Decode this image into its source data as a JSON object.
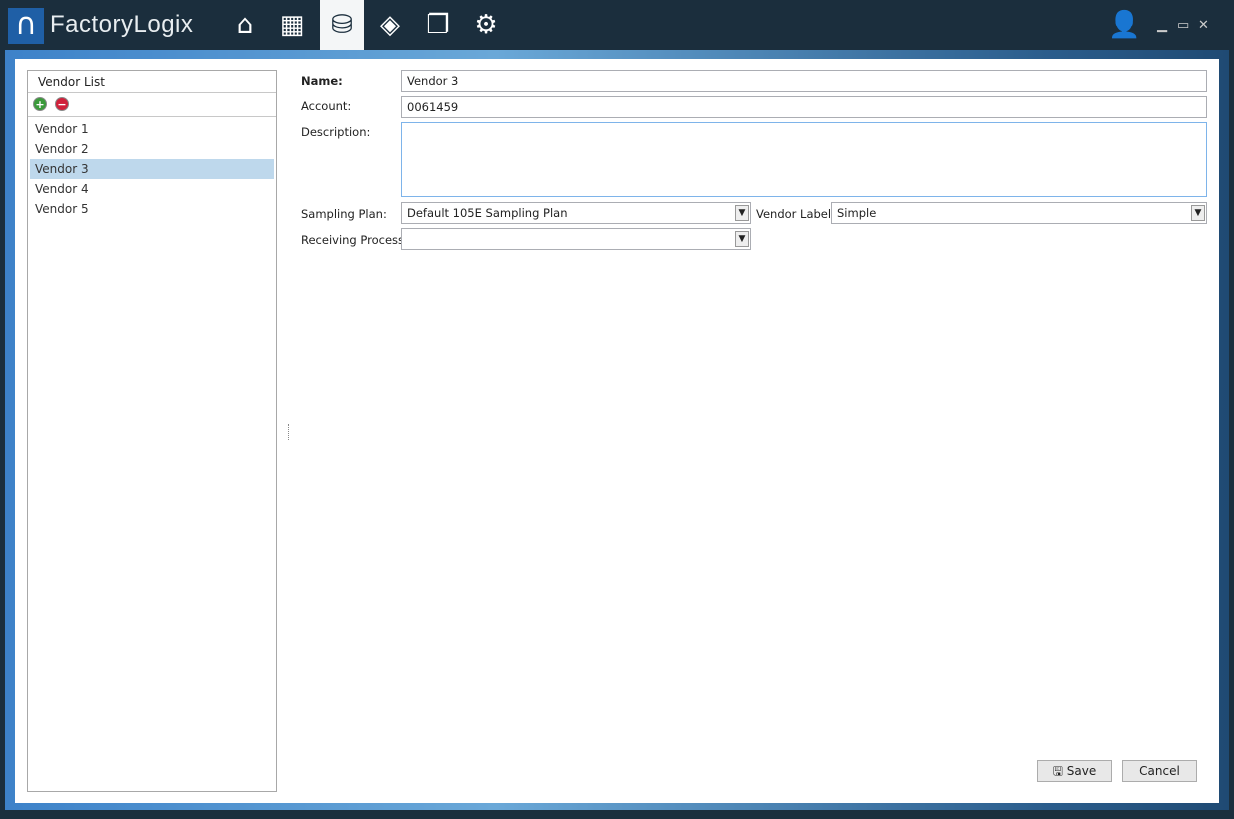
{
  "app": {
    "logo": "FactoryLogix",
    "nav": [
      {
        "icon": "home-icon"
      },
      {
        "icon": "grid-edit-icon"
      },
      {
        "icon": "database-icon",
        "active": true
      },
      {
        "icon": "routing-icon"
      },
      {
        "icon": "windows-icon"
      },
      {
        "icon": "gear-icon"
      }
    ]
  },
  "vendor_list": {
    "title": "Vendor List",
    "items": [
      "Vendor 1",
      "Vendor 2",
      "Vendor 3",
      "Vendor 4",
      "Vendor 5"
    ],
    "selected": "Vendor 3"
  },
  "form": {
    "name_label": "Name:",
    "name": "Vendor 3",
    "account_label": "Account:",
    "account": "0061459",
    "description_label": "Description:",
    "description": "",
    "sampling_label": "Sampling Plan:",
    "sampling": "Default 105E Sampling Plan",
    "vendor_label_label": "Vendor Label:",
    "vendor_label": "Simple",
    "receiving_label": "Receiving Process:",
    "receiving": ""
  },
  "buttons": {
    "save": "Save",
    "cancel": "Cancel"
  }
}
